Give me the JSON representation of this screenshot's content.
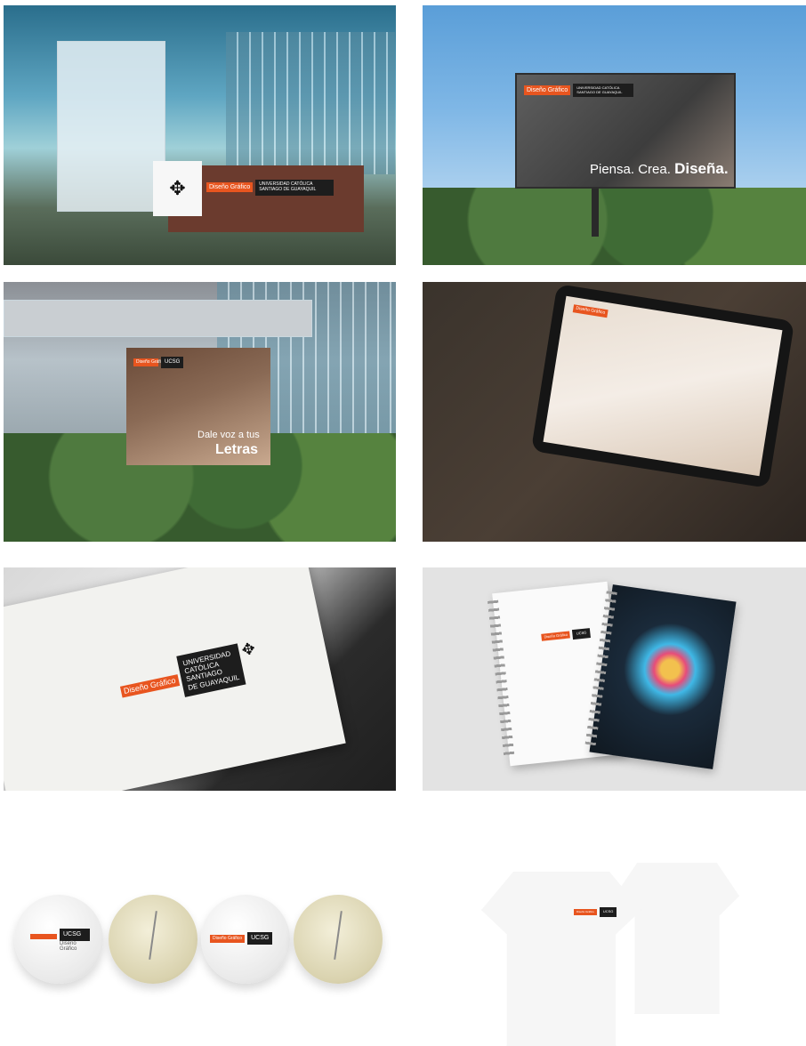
{
  "logo": {
    "program": "Diseño Gráfico",
    "institution": "UNIVERSIDAD CATÓLICA SANTIAGO DE GUAYAQUIL",
    "institution_lines": [
      "UNIVERSIDAD",
      "CATÓLICA",
      "SANTIAGO",
      "DE GUAYAQUIL"
    ],
    "acronym": "UCSG",
    "cross_glyph": "✥"
  },
  "billboard": {
    "word1": "Piensa.",
    "word2": "Crea.",
    "word3": "Diseña."
  },
  "banner": {
    "line1": "Dale voz a tus",
    "line2": "Letras"
  },
  "badges": {
    "badge1_sub": "Diseño Gráfico"
  },
  "colors": {
    "brand_orange": "#e8551f",
    "brand_black": "#1d1d1d"
  }
}
